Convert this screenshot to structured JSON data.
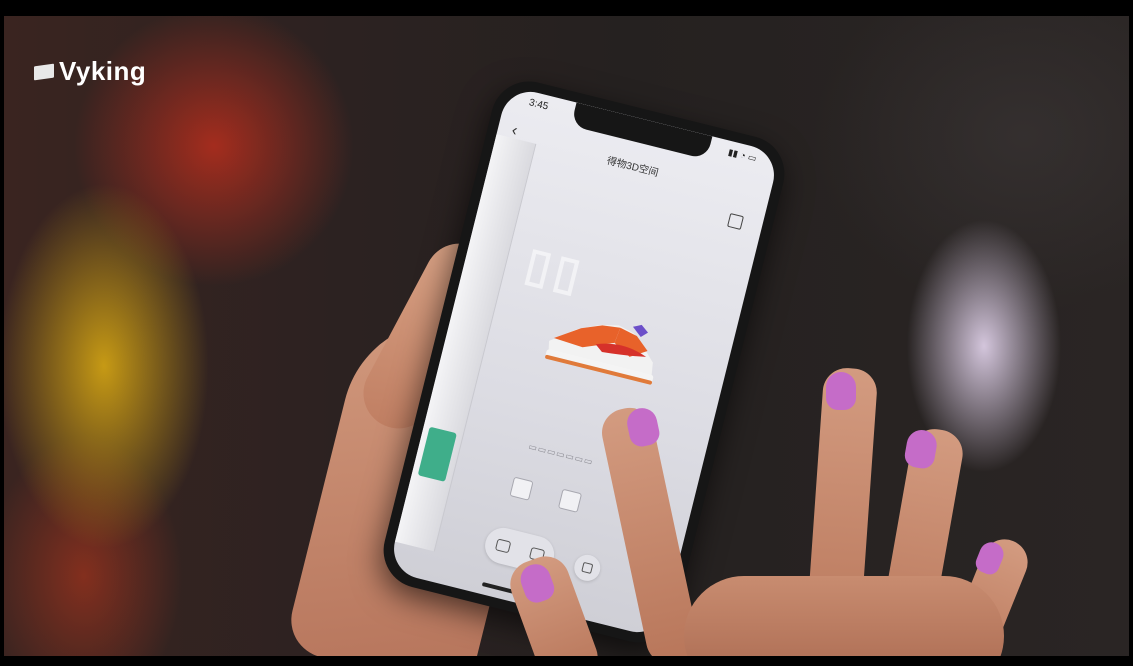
{
  "brand": {
    "name": "Vyking"
  },
  "phone_screen": {
    "status_time": "3:45",
    "title": "得物3D空间"
  },
  "colors": {
    "nail_polish": "#c56cc8",
    "shoe_orange": "#e8622a",
    "shoe_red": "#d6312a",
    "brand_white": "#ffffff",
    "accent_green": "#3fae8a"
  },
  "icons": [
    "brand-logo-icon",
    "back-chevron-icon",
    "share-icon",
    "camera-icon",
    "video-icon",
    "shopping-bag-icon"
  ]
}
